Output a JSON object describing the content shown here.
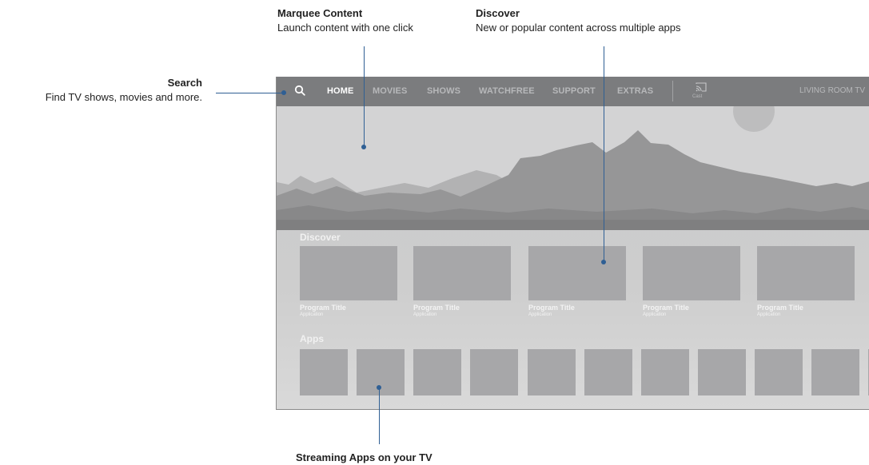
{
  "callouts": {
    "search": {
      "title": "Search",
      "desc": "Find TV shows, movies and more."
    },
    "marquee": {
      "title": "Marquee Content",
      "desc": "Launch content with one click"
    },
    "discover": {
      "title": "Discover",
      "desc": "New or popular content across multiple apps"
    },
    "apps": {
      "title": "Streaming Apps on your TV"
    }
  },
  "tv": {
    "nav": {
      "items": [
        "HOME",
        "MOVIES",
        "SHOWS",
        "WATCHFREE",
        "SUPPORT",
        "EXTRAS"
      ],
      "active": "HOME",
      "cast_label": "Cast",
      "device_name": "LIVING ROOM TV"
    },
    "discover": {
      "label": "Discover",
      "cards": [
        {
          "title": "Program Title",
          "app": "Application"
        },
        {
          "title": "Program Title",
          "app": "Application"
        },
        {
          "title": "Program Title",
          "app": "Application"
        },
        {
          "title": "Program Title",
          "app": "Application"
        },
        {
          "title": "Program Title",
          "app": "Application"
        }
      ]
    },
    "apps": {
      "label": "Apps",
      "tile_count": 11
    }
  },
  "colors": {
    "callout_line": "#2f5f94",
    "navbar": "#7b7c7e",
    "tile": "#a7a7a9"
  }
}
